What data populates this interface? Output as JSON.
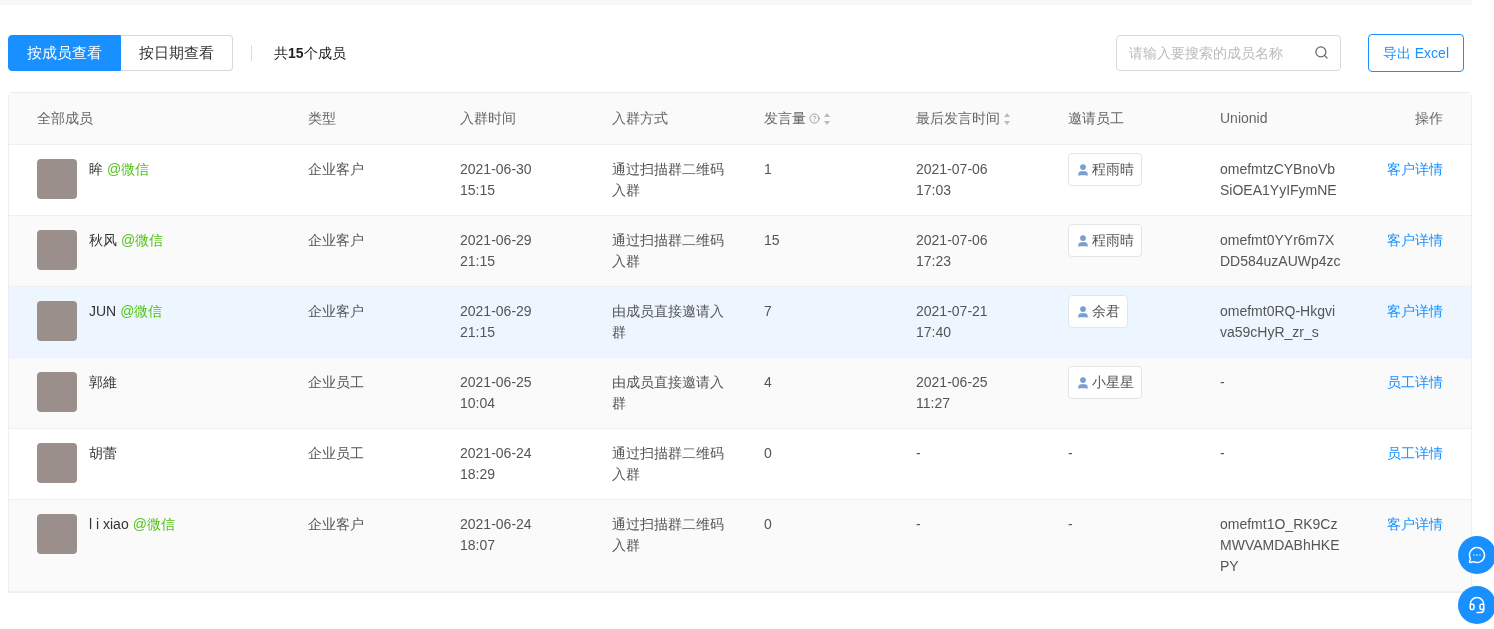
{
  "view_tabs": [
    {
      "label": "按成员查看",
      "selected": true
    },
    {
      "label": "按日期查看",
      "selected": false
    }
  ],
  "member_count": "共**15**个成员",
  "search": {
    "placeholder": "请输入要搜索的成员名称"
  },
  "export_button": "导出 Excel",
  "table": {
    "columns": [
      {
        "label": "全部成员",
        "help": false,
        "sortable": false
      },
      {
        "label": "类型",
        "help": false,
        "sortable": false
      },
      {
        "label": "入群时间",
        "help": false,
        "sortable": false
      },
      {
        "label": "入群方式",
        "help": false,
        "sortable": false
      },
      {
        "label": "发言量",
        "help": true,
        "sortable": true
      },
      {
        "label": "最后发言时间",
        "help": false,
        "sortable": true
      },
      {
        "label": "邀请员工",
        "help": false,
        "sortable": false
      },
      {
        "label": "Unionid",
        "help": false,
        "sortable": false
      },
      {
        "label": "操作",
        "help": false,
        "sortable": false
      }
    ],
    "rows": [
      {
        "name": "眸",
        "source": "@微信",
        "type": "企业客户",
        "join_time": "2021-06-30 15:15",
        "join_method": "通过扫描群二维码入群",
        "messages": "1",
        "last_message_time": "2021-07-06 17:03",
        "inviter": "程雨晴",
        "unionid": "omefmtzCYBnoVbSiOEA1YyIFymNE",
        "action": "客户详情",
        "hovered": false
      },
      {
        "name": "秋风",
        "source": "@微信",
        "type": "企业客户",
        "join_time": "2021-06-29 21:15",
        "join_method": "通过扫描群二维码入群",
        "messages": "15",
        "last_message_time": "2021-07-06 17:23",
        "inviter": "程雨晴",
        "unionid": "omefmt0YYr6m7XDD584uzAUWp4zc",
        "action": "客户详情",
        "hovered": false
      },
      {
        "name": "JUN",
        "source": "@微信",
        "type": "企业客户",
        "join_time": "2021-06-29 21:15",
        "join_method": "由成员直接邀请入群",
        "messages": "7",
        "last_message_time": "2021-07-21 17:40",
        "inviter": "余君",
        "unionid": "omefmt0RQ-Hkgviva59cHyR_zr_s",
        "action": "客户详情",
        "hovered": true
      },
      {
        "name": "郭維",
        "type": "企业员工",
        "join_time": "2021-06-25 10:04",
        "join_method": "由成员直接邀请入群",
        "messages": "4",
        "last_message_time": "2021-06-25 11:27",
        "inviter": "小星星",
        "unionid": "-",
        "action": "员工详情",
        "hovered": false
      },
      {
        "name": "胡蕾",
        "type": "企业员工",
        "join_time": "2021-06-24 18:29",
        "join_method": "通过扫描群二维码入群",
        "messages": "0",
        "last_message_time": "-",
        "inviter_placeholder": "-",
        "unionid": "-",
        "action": "员工详情",
        "hovered": false
      },
      {
        "name": "l i xiao",
        "source": "@微信",
        "type": "企业客户",
        "join_time": "2021-06-24 18:07",
        "join_method": "通过扫描群二维码入群",
        "messages": "0",
        "last_message_time": "-",
        "inviter_placeholder": "-",
        "unionid": "omefmt1O_RK9CzMWVAMDABhHKEPY",
        "action": "客户详情",
        "hovered": false
      }
    ]
  }
}
